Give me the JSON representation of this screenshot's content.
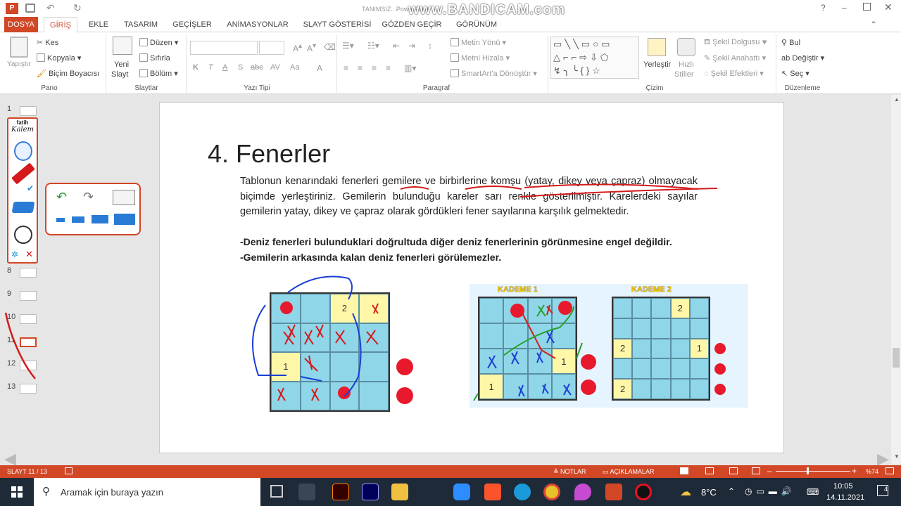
{
  "titlebar": {
    "watermark": "www.BANDICAM.com",
    "app_hint": "TANIMSIZ...PowerPoint",
    "help": "?"
  },
  "tabs": [
    "DOSYA",
    "GİRİŞ",
    "EKLE",
    "TASARIM",
    "GEÇİŞLER",
    "ANİMASYONLAR",
    "SLAYT GÖSTERİSİ",
    "GÖZDEN GEÇİR",
    "GÖRÜNÜM"
  ],
  "ribbon": {
    "clipboard": {
      "paste": "Yapıştır",
      "cut": "Kes",
      "copy": "Kopyala",
      "format_painter": "Biçim Boyacısı",
      "label": "Pano"
    },
    "slides": {
      "new_slide_1": "Yeni",
      "new_slide_2": "Slayt",
      "layout": "Düzen",
      "reset": "Sıfırla",
      "section": "Bölüm",
      "label": "Slaytlar"
    },
    "font": {
      "label": "Yazı Tipi",
      "bold": "K",
      "italic": "T",
      "underline": "A",
      "strike": "S",
      "spacing": "abc",
      "case": "Aa",
      "color": "A"
    },
    "paragraph": {
      "text_direction": "Metin Yönü",
      "align_text": "Metni Hizala",
      "smartart": "SmartArt'a Dönüştür",
      "label": "Paragraf"
    },
    "drawing": {
      "arrange": "Yerleştir",
      "quick_styles_1": "Hızlı",
      "quick_styles_2": "Stiller",
      "shape_fill": "Şekil Dolgusu",
      "shape_outline": "Şekil Anahattı",
      "shape_effects": "Şekil Efektleri",
      "label": "Çizim"
    },
    "editing": {
      "find": "Bul",
      "replace": "Değiştir",
      "select": "Seç",
      "label": "Düzenleme"
    }
  },
  "thumbnails": [
    "1",
    "8",
    "9",
    "10",
    "11",
    "12",
    "13"
  ],
  "fatih_kalem": {
    "title_1": "fatih",
    "title_2": "Kalem"
  },
  "slide": {
    "title": "4. Fenerler",
    "para1": "Tablonun kenarındaki fenerleri gemilere ve birbirlerine komşu (yatay, dikey veya çapraz) olmayacak biçimde yerleştiriniz. Gemilerin bulunduğu kareler sarı renkle gösterilmiştir. Karelerdeki sayılar gemilerin yatay, dikey ve çapraz olarak gördükleri fener sayılarına karşılık gelmektedir.",
    "rule1": "-Deniz fenerleri bulunduklari doğrultuda diğer deniz fenerlerinin görünmesine engel değildir.",
    "rule2": "-Gemilerin arkasında kalan deniz fenerleri görülemezler.",
    "kademe1": "KADEME 1",
    "kademe2": "KADEME 2",
    "grid_main": {
      "n2": "2",
      "n1": "1"
    },
    "grid_k1": {
      "n1": "1",
      "n1b": "1"
    },
    "grid_k2": {
      "n2a": "2",
      "n2b": "2",
      "n1": "1",
      "n2c": "2"
    }
  },
  "status": {
    "slide": "SLAYT 11 / 13",
    "notes": "NOTLAR",
    "comments": "AÇIKLAMALAR",
    "zoom": "%74"
  },
  "taskbar": {
    "search_placeholder": "Aramak için buraya yazın",
    "temp": "8°C",
    "time": "10:05",
    "date": "14.11.2021",
    "notif": "4"
  },
  "colors": {
    "accent": "#d24726",
    "ship": "#fff7a8",
    "sea": "#8fd6e8",
    "lighthouse": "#e8192c"
  }
}
